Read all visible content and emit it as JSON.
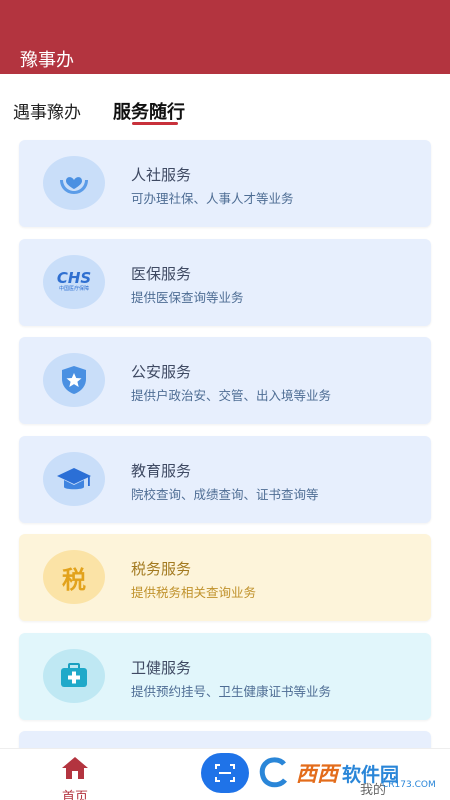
{
  "header": {
    "title": "豫事办"
  },
  "tabs": [
    {
      "label": "遇事豫办"
    },
    {
      "label": "服务随行"
    }
  ],
  "services": [
    {
      "title": "人社服务",
      "desc": "可办理社保、人事人才等业务",
      "icon": "hands-heart-icon",
      "theme": "blue"
    },
    {
      "title": "医保服务",
      "desc": "提供医保查询等业务",
      "icon": "chs-medical-insurance-logo",
      "icon_text": "CHS",
      "icon_sub": "中国医疗保障",
      "theme": "blue"
    },
    {
      "title": "公安服务",
      "desc": "提供户政治安、交管、出入境等业务",
      "icon": "police-shield-star-icon",
      "theme": "blue"
    },
    {
      "title": "教育服务",
      "desc": "院校查询、成绩查询、证书查询等",
      "icon": "graduation-cap-icon",
      "theme": "blue"
    },
    {
      "title": "税务服务",
      "desc": "提供税务相关查询业务",
      "icon": "tax-character-icon",
      "icon_text": "税",
      "theme": "yellow"
    },
    {
      "title": "卫健服务",
      "desc": "提供预约挂号、卫生健康证书等业务",
      "icon": "medical-kit-icon",
      "theme": "cyan"
    }
  ],
  "tabbar": {
    "home_label": "首页",
    "mine_label": "我的"
  },
  "watermark": {
    "text1": "西西",
    "text2": "软件园",
    "sub": "CR173.COM"
  },
  "colors": {
    "header": "#b3343f",
    "accent": "#c8313b",
    "scan": "#1f73e8"
  }
}
